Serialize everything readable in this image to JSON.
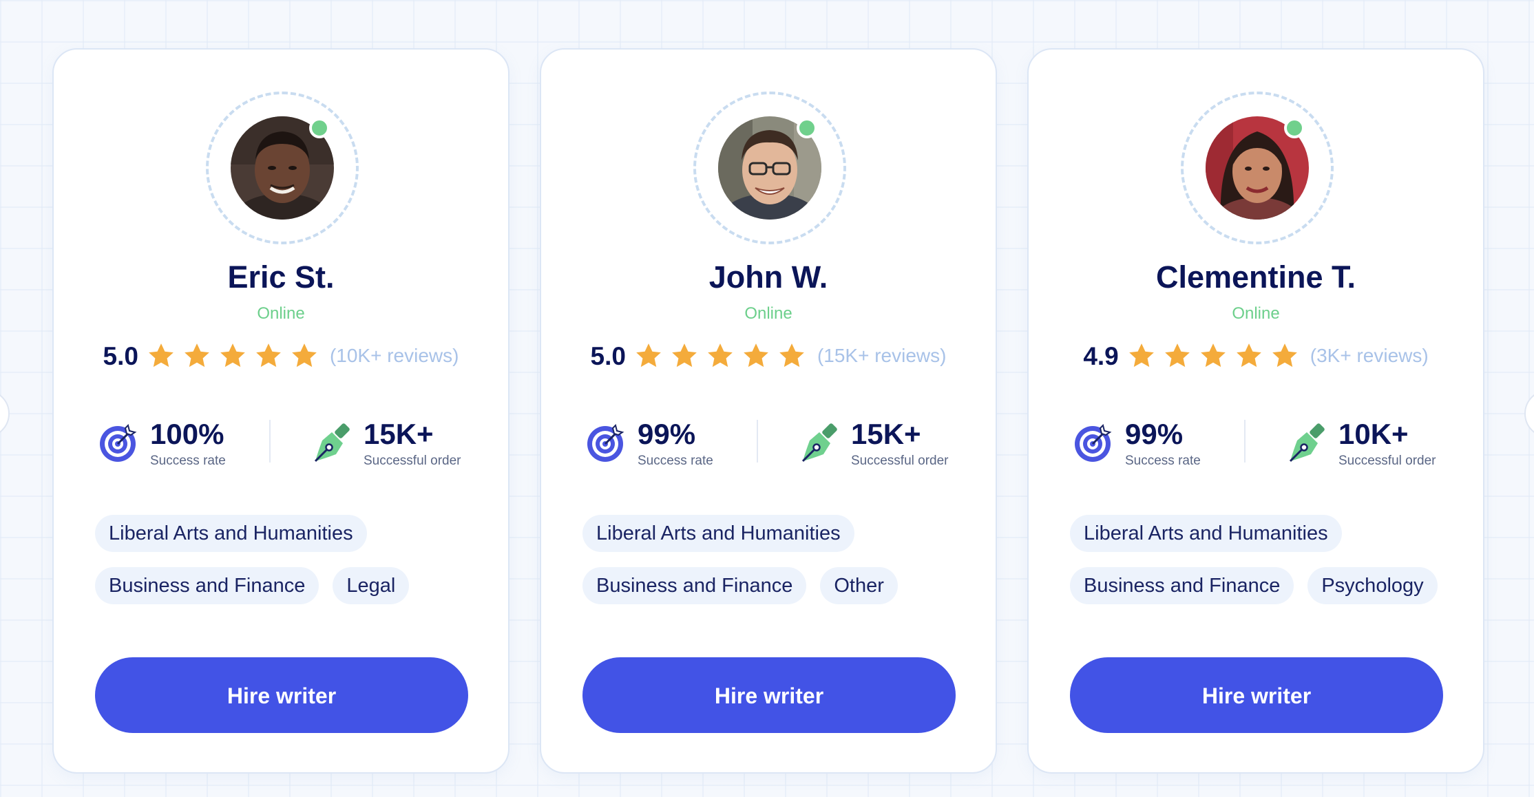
{
  "colors": {
    "accent": "#4253e6",
    "online": "#70d08c",
    "star": "#f4ab3b",
    "name": "#0b1558",
    "reviews": "#a8c2e8",
    "tag_bg": "#edf3fc"
  },
  "writers": [
    {
      "name": "Eric St.",
      "status": "Online",
      "rating": "5.0",
      "stars": 5,
      "reviews": "(10K+ reviews)",
      "success_value": "100%",
      "success_label": "Success rate",
      "orders_value": "15K+",
      "orders_label": "Successful order",
      "tags_row1": [
        "Liberal Arts and Humanities"
      ],
      "tags_row2": [
        "Business and Finance",
        "Legal"
      ],
      "button": "Hire writer"
    },
    {
      "name": "John W.",
      "status": "Online",
      "rating": "5.0",
      "stars": 5,
      "reviews": "(15K+ reviews)",
      "success_value": "99%",
      "success_label": "Success rate",
      "orders_value": "15K+",
      "orders_label": "Successful order",
      "tags_row1": [
        "Liberal Arts and Humanities"
      ],
      "tags_row2": [
        "Business and Finance",
        "Other"
      ],
      "button": "Hire writer"
    },
    {
      "name": "Clementine T.",
      "status": "Online",
      "rating": "4.9",
      "stars": 5,
      "reviews": "(3K+ reviews)",
      "success_value": "99%",
      "success_label": "Success rate",
      "orders_value": "10K+",
      "orders_label": "Successful order",
      "tags_row1": [
        "Liberal Arts and Humanities"
      ],
      "tags_row2": [
        "Business and Finance",
        "Psychology"
      ],
      "button": "Hire writer"
    }
  ],
  "icons": {
    "avatar": "avatar-photo",
    "online": "online-dot",
    "star": "star-icon",
    "success": "target-icon",
    "orders": "pen-nib-icon",
    "prev": "carousel-prev",
    "next": "carousel-next"
  }
}
